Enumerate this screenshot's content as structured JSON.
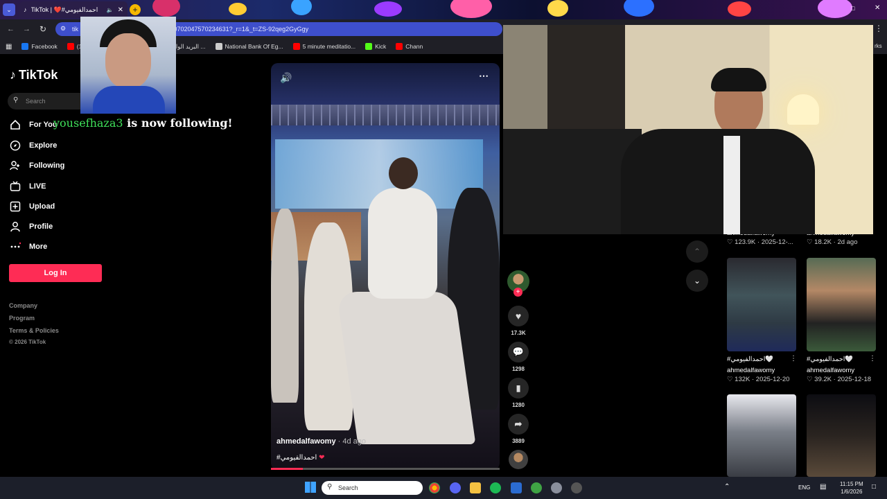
{
  "browser": {
    "tab_title": "TikTok | ❤️#احمدالفيومي",
    "url": "/7590702047570234631?_r=1&_t=ZS-92qeg2GyGgy",
    "url_prefix": "tik",
    "bookmarks": [
      {
        "label": "Facebook",
        "color": "#1877f2"
      },
      {
        "label": "(10)Hazem Moham...",
        "color": "#ff0000"
      },
      {
        "label": "(174) - البريد الوارد ...",
        "color": "#c5221f"
      },
      {
        "label": "National Bank Of Eg...",
        "color": "#cccccc"
      },
      {
        "label": "5 minute meditatio...",
        "color": "#ff0000"
      },
      {
        "label": "Kick",
        "color": "#53fc18"
      },
      {
        "label": "Chann",
        "color": "#ff0000"
      }
    ],
    "bookmarks_overflow": "rks"
  },
  "sidebar": {
    "logo": "TikTok",
    "search_placeholder": "Search",
    "nav": [
      {
        "label": "For You",
        "icon": "home-icon"
      },
      {
        "label": "Explore",
        "icon": "compass-icon"
      },
      {
        "label": "Following",
        "icon": "following-icon"
      },
      {
        "label": "LIVE",
        "icon": "live-icon"
      },
      {
        "label": "Upload",
        "icon": "upload-icon"
      },
      {
        "label": "Profile",
        "icon": "profile-icon"
      },
      {
        "label": "More",
        "icon": "more-icon"
      }
    ],
    "login_label": "Log In",
    "footer": [
      "Company",
      "Program",
      "Terms & Policies"
    ],
    "copyright": "© 2026 TikTok"
  },
  "overlay": {
    "follower": "yousefhaza3",
    "follow_text": "is now following!"
  },
  "video": {
    "username": "ahmedalfawomy",
    "age": "· 4d ago",
    "caption": "#احمدالفيومي",
    "progress": 0.14,
    "actions": {
      "likes": "17.3K",
      "comments": "1298",
      "saves": "1280",
      "shares": "3889"
    }
  },
  "grid": [
    {
      "caption": "",
      "user": "ahmedalfawomy",
      "views": "123.9K",
      "date": "2025-12-..."
    },
    {
      "caption": "",
      "user": "ahmedalfawomy",
      "views": "18.2K",
      "date": "2d ago"
    },
    {
      "caption": "#احمدالفيومي🤍",
      "user": "ahmedalfawomy",
      "views": "132K",
      "date": "2025-12-20"
    },
    {
      "caption": "#احمدالفيومي🤍",
      "user": "ahmedalfawomy",
      "views": "39.2K",
      "date": "2025-12-18"
    }
  ],
  "taskbar": {
    "search_placeholder": "Search",
    "lang": "ENG",
    "time": "11:15 PM",
    "date": "1/6/2026"
  }
}
